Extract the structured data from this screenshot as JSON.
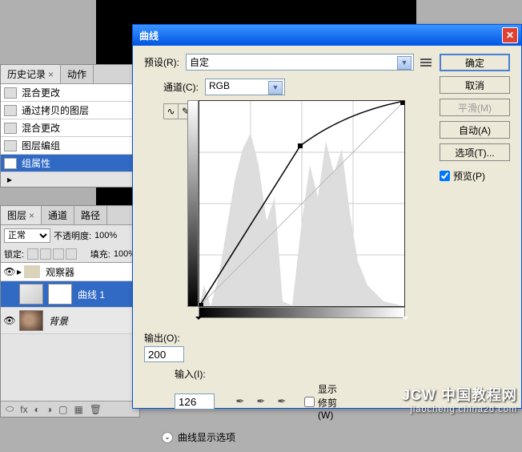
{
  "history_panel": {
    "tab_history": "历史记录",
    "tab_actions": "动作",
    "items": [
      "混合更改",
      "通过拷贝的图层",
      "混合更改",
      "图层编组",
      "组属性"
    ]
  },
  "layers_panel": {
    "tab_layers": "图层",
    "tab_channels": "通道",
    "tab_paths": "路径",
    "blend_mode": "正常",
    "opacity_label": "不透明度:",
    "opacity_value": "100%",
    "lock_label": "锁定:",
    "fill_label": "填充:",
    "fill_value": "100%",
    "items": {
      "group": "观察器",
      "curves": "曲线 1",
      "background": "背景"
    }
  },
  "dialog": {
    "title": "曲线",
    "preset_label": "预设(R):",
    "preset_value": "自定",
    "channel_label": "通道(C):",
    "channel_value": "RGB",
    "output_label": "输出(O):",
    "output_value": "200",
    "input_label": "输入(I):",
    "input_value": "126",
    "clip_label": "显示修剪(W)",
    "expand_label": "曲线显示选项",
    "btn_ok": "确定",
    "btn_cancel": "取消",
    "btn_smooth": "平滑(M)",
    "btn_auto": "自动(A)",
    "btn_options": "选项(T)...",
    "preview_label": "预览(P)"
  },
  "chart_data": {
    "type": "line",
    "title": "Curves",
    "xlabel": "Input",
    "ylabel": "Output",
    "xlim": [
      0,
      255
    ],
    "ylim": [
      0,
      255
    ],
    "points": [
      {
        "input": 0,
        "output": 0
      },
      {
        "input": 126,
        "output": 200
      },
      {
        "input": 255,
        "output": 255
      }
    ],
    "baseline": [
      {
        "input": 0,
        "output": 0
      },
      {
        "input": 255,
        "output": 255
      }
    ]
  },
  "watermark": {
    "main": "JCW 中国教程网",
    "sub": "jiaocheng.china2d.com"
  }
}
